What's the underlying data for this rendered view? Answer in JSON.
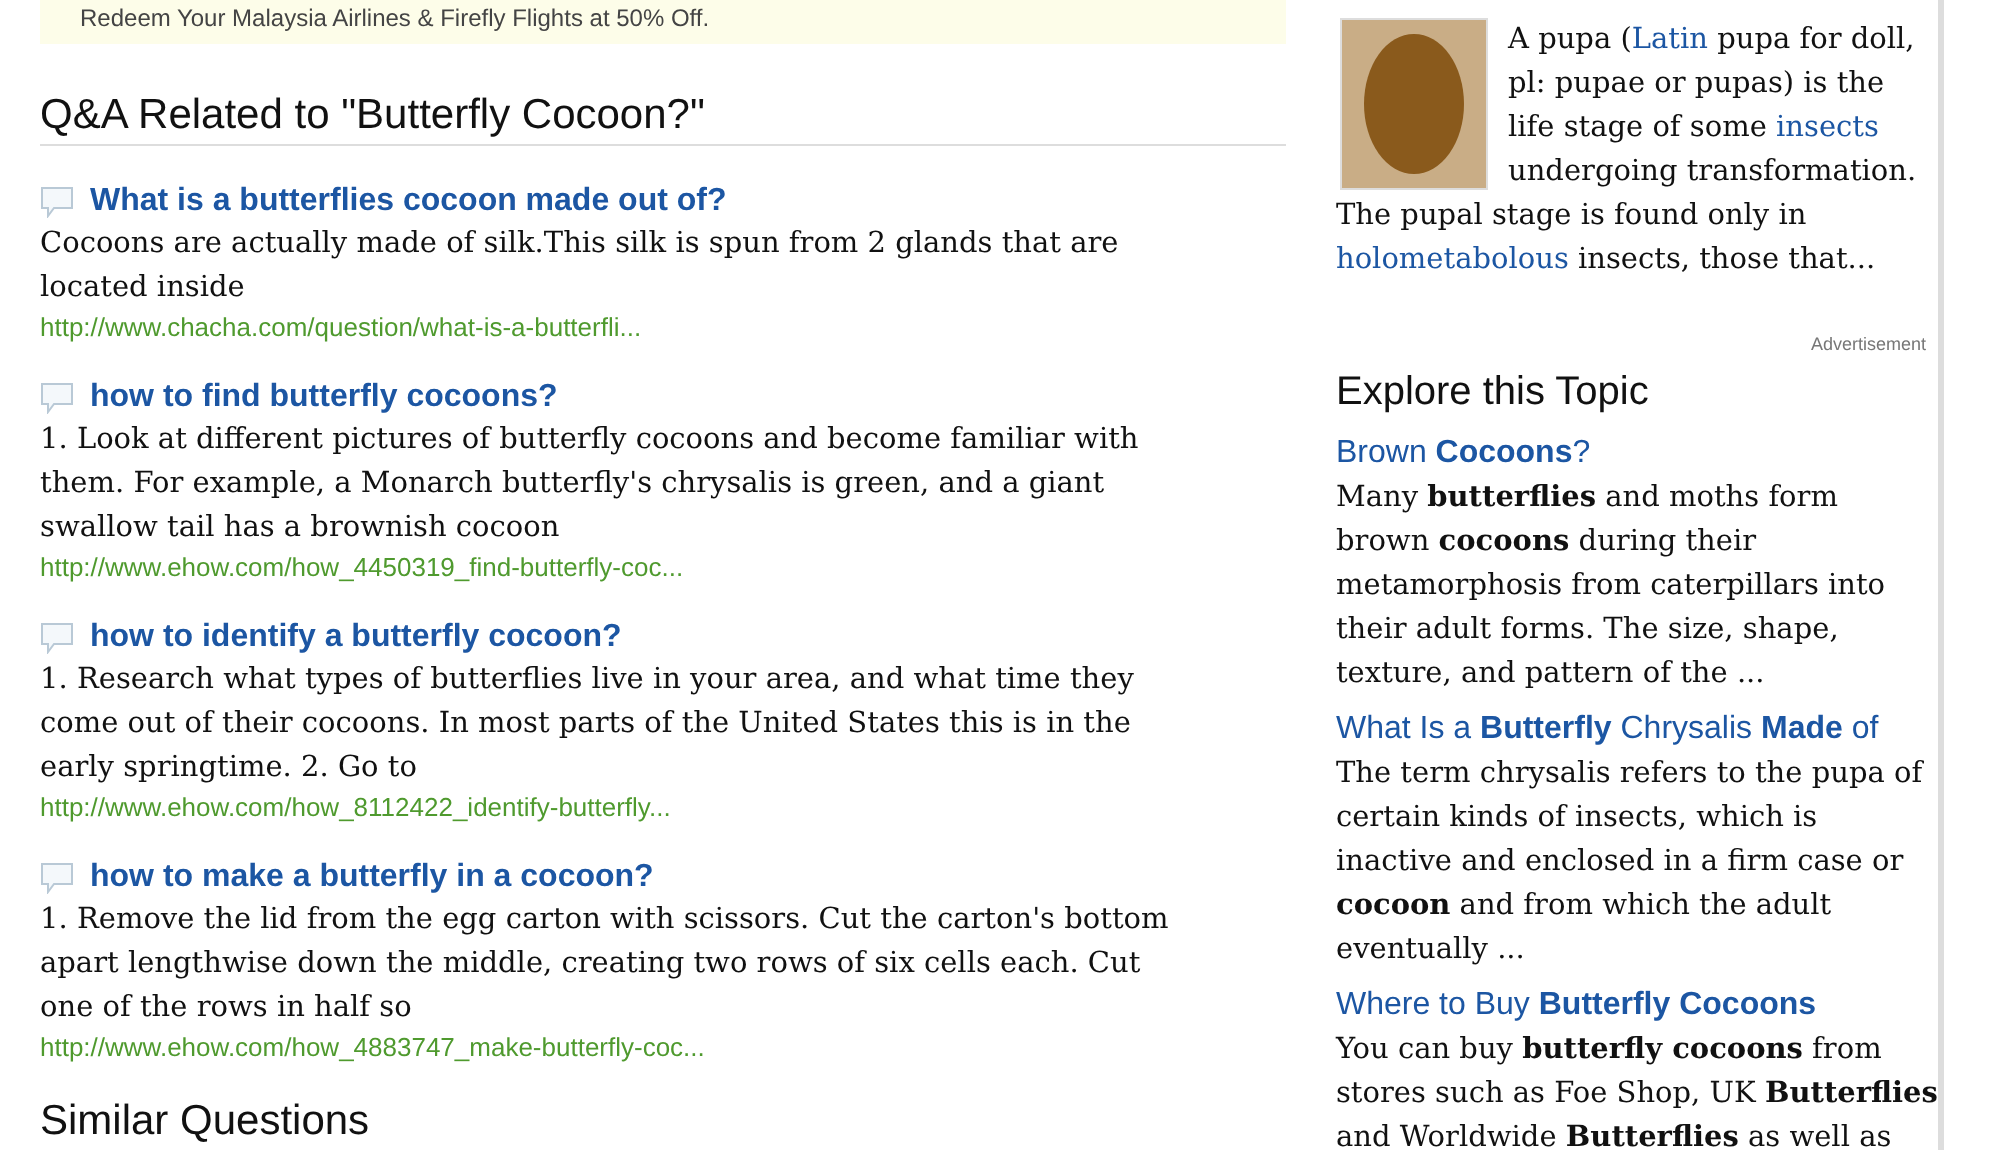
{
  "banner": {
    "text": "Redeem Your Malaysia Airlines & Firefly Flights at 50% Off."
  },
  "qa": {
    "heading": "Q&A Related to \"Butterfly Cocoon?\"",
    "items": [
      {
        "question": "What is a butterflies cocoon made out of?",
        "answer": "Cocoons are actually made of silk.This silk is spun from 2 glands that are located inside",
        "url": "http://www.chacha.com/question/what-is-a-butterfli..."
      },
      {
        "question": "how to find butterfly cocoons?",
        "answer": "1. Look at different pictures of butterfly cocoons and become familiar with them. For example, a Monarch butterfly's chrysalis is green, and a giant swallow tail has a brownish cocoon",
        "url": "http://www.ehow.com/how_4450319_find-butterfly-coc..."
      },
      {
        "question": "how to identify a butterfly cocoon?",
        "answer": "1. Research what types of butterflies live in your area, and what time they come out of their cocoons. In most parts of the United States this is in the early springtime. 2. Go to",
        "url": "http://www.ehow.com/how_8112422_identify-butterfly..."
      },
      {
        "question": "how to make a butterfly in a cocoon?",
        "answer": "1. Remove the lid from the egg carton with scissors. Cut the carton's bottom apart lengthwise down the middle, creating two rows of six cells each. Cut one of the rows in half so",
        "url": "http://www.ehow.com/how_4883747_make-butterfly-coc..."
      }
    ]
  },
  "similar": {
    "heading": "Similar Questions"
  },
  "pupa": {
    "segments": [
      {
        "kind": "text",
        "text": "A pupa ("
      },
      {
        "kind": "link",
        "text": "Latin"
      },
      {
        "kind": "text",
        "text": " pupa for doll, pl: pupae or pupas) is the life stage of some "
      },
      {
        "kind": "link",
        "text": "insects"
      },
      {
        "kind": "text",
        "text": " undergoing transformation. The pupal stage is found only in "
      },
      {
        "kind": "link",
        "text": "holometabolous"
      },
      {
        "kind": "text",
        "text": " insects, those that..."
      }
    ]
  },
  "advertisement": "Advertisement",
  "explore": {
    "heading": "Explore this Topic",
    "items": [
      {
        "title": "Brown **Cocoons**?",
        "text": "Many **butterflies** and moths form brown **cocoons** during their metamorphosis from caterpillars into their adult forms. The size, shape, texture, and pattern of the ..."
      },
      {
        "title": "What Is a **Butterfly** Chrysalis **Made** of",
        "text": "The term chrysalis refers to the pupa of certain kinds of insects, which is inactive and enclosed in a firm case or **cocoon** and from which the adult eventually ..."
      },
      {
        "title": "Where to Buy **Butterfly Cocoons**",
        "text": "You can buy **butterfly cocoons** from stores such as Foe Shop, UK **Butterflies** and Worldwide **Butterflies** as well as"
      }
    ]
  }
}
